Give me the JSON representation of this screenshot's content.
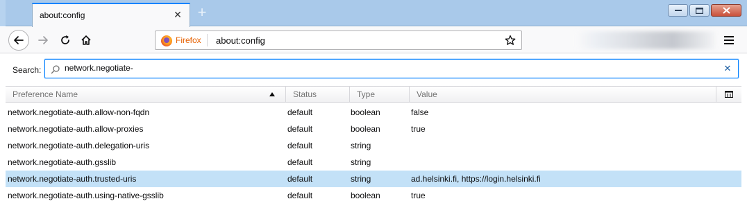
{
  "tab": {
    "title": "about:config"
  },
  "navbar": {
    "identity_label": "Firefox",
    "url": "about:config"
  },
  "search": {
    "label": "Search:",
    "value": "network.negotiate-"
  },
  "table": {
    "columns": [
      "Preference Name",
      "Status",
      "Type",
      "Value"
    ],
    "sort": {
      "column": "Preference Name",
      "direction": "ascending"
    },
    "rows": [
      {
        "name": "network.negotiate-auth.allow-non-fqdn",
        "status": "default",
        "type": "boolean",
        "value": "false",
        "selected": false
      },
      {
        "name": "network.negotiate-auth.allow-proxies",
        "status": "default",
        "type": "boolean",
        "value": "true",
        "selected": false
      },
      {
        "name": "network.negotiate-auth.delegation-uris",
        "status": "default",
        "type": "string",
        "value": "",
        "selected": false
      },
      {
        "name": "network.negotiate-auth.gsslib",
        "status": "default",
        "type": "string",
        "value": "",
        "selected": false
      },
      {
        "name": "network.negotiate-auth.trusted-uris",
        "status": "default",
        "type": "string",
        "value": "ad.helsinki.fi, https://login.helsinki.fi",
        "selected": true
      },
      {
        "name": "network.negotiate-auth.using-native-gsslib",
        "status": "default",
        "type": "boolean",
        "value": "true",
        "selected": false
      }
    ]
  },
  "colors": {
    "accent": "#0a84ff",
    "selected_row": "#c3e1f7",
    "identity": "#e66000",
    "titlebar": "#a9c9ea"
  },
  "icons": {
    "back": "arrow-left-icon",
    "forward": "arrow-right-icon",
    "reload": "reload-icon",
    "home": "home-icon",
    "bookmark": "star-icon",
    "menu": "hamburger-menu-icon",
    "search": "magnifier-icon",
    "clear": "close-icon",
    "column_picker": "column-picker-icon"
  }
}
